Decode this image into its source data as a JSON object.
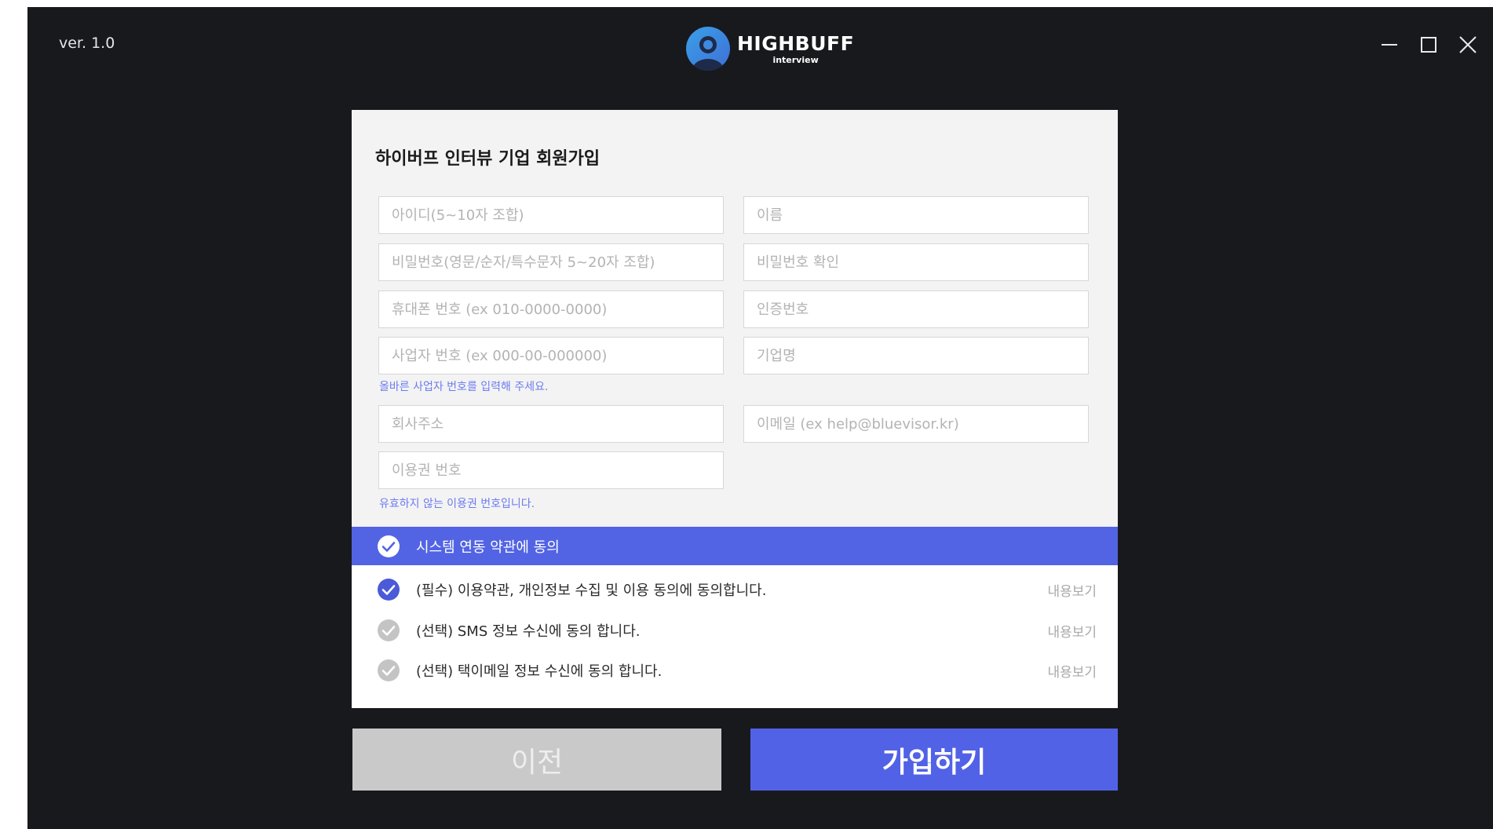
{
  "app": {
    "version": "ver. 1.0",
    "brand_name": "HIGHBUFF",
    "brand_sub": "interview"
  },
  "icons": {
    "logo": "person-avatar-icon",
    "minimize": "minimize-icon",
    "maximize": "maximize-icon",
    "close": "close-icon",
    "check": "check-circle-icon"
  },
  "colors": {
    "window_bg": "#18191d",
    "accent": "#5264e4",
    "hint": "#6c7cf0"
  },
  "form": {
    "title": "하이버프 인터뷰 기업 회원가입",
    "fields": {
      "user_id": "아이디(5~10자 조합)",
      "name": "이름",
      "password": "비밀번호(영문/순자/특수문자 5~20자 조합)",
      "password_confirm": "비밀번호 확인",
      "phone": "휴대폰 번호 (ex 010-0000-0000)",
      "verification_code": "인증번호",
      "business_number": "사업자 번호 (ex 000-00-000000)",
      "company_name": "기업명",
      "company_address": "회사주소",
      "email": "이메일 (ex help@bluevisor.kr)",
      "voucher_number": "이용권 번호"
    },
    "hints": {
      "business_number": "올바른 사업자 번호를 입력해 주세요.",
      "voucher_number": "유효하지 않는 이용권 번호입니다."
    }
  },
  "agreements": {
    "all_label": "시스템 연동 약관에 동의",
    "view_label": "내용보기",
    "items": [
      {
        "label": "(필수) 이용약관, 개인정보 수집 및 이용 동의에 동의합니다.",
        "checked": true
      },
      {
        "label": "(선택) SMS 정보 수신에 동의 합니다.",
        "checked": false
      },
      {
        "label": "(선택) 택이메일 정보 수신에 동의 합니다.",
        "checked": false
      }
    ]
  },
  "buttons": {
    "prev": "이전",
    "join": "가입하기"
  }
}
